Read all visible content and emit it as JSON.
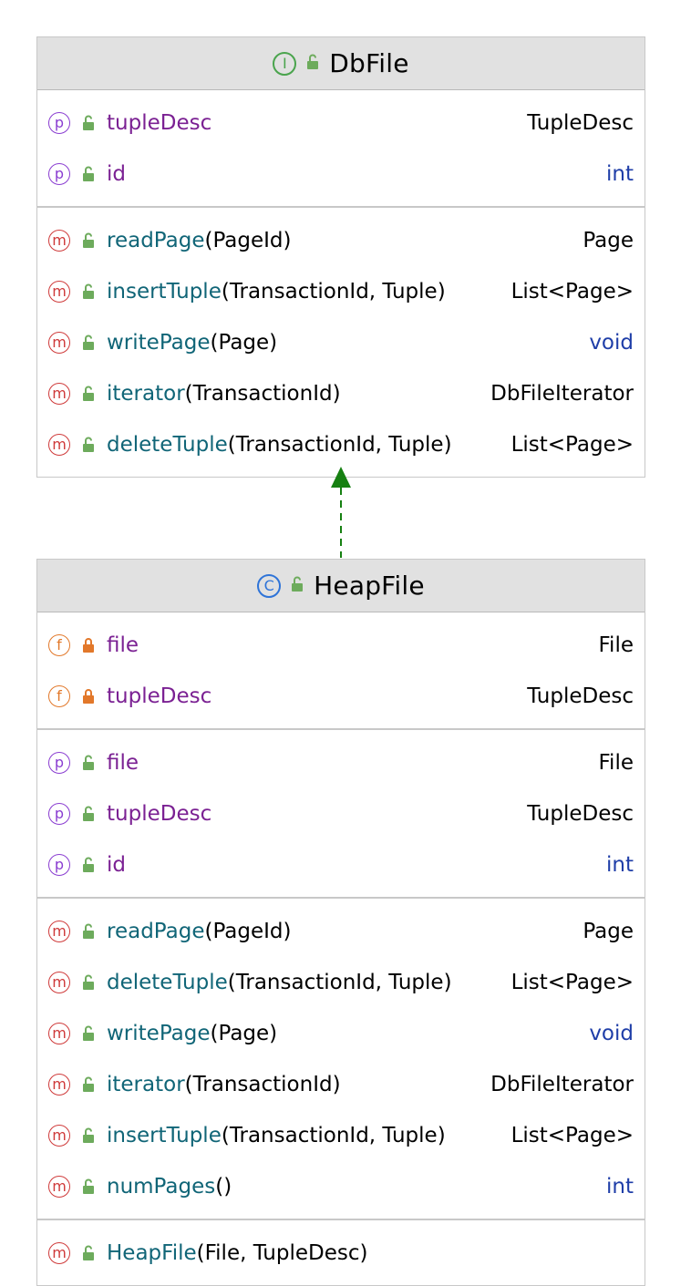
{
  "colors": {
    "header_bg": "#e1e1e1",
    "field_name": "#7b2193",
    "method_name": "#106577",
    "primitive_type": "#1f3ea8",
    "interface_icon": "#4aa44d",
    "class_icon": "#2f74d8",
    "arrow": "#168011",
    "visibility_public": "#6dab5c",
    "visibility_private": "#e2782a"
  },
  "interface": {
    "name": "DbFile",
    "kind_icon": "interface-icon",
    "kind_glyph": "I",
    "sections": [
      {
        "rows": [
          {
            "kind": "p",
            "vis": "public",
            "name": "tupleDesc",
            "args": "",
            "type": "TupleDesc",
            "type_primitive": false
          },
          {
            "kind": "p",
            "vis": "public",
            "name": "id",
            "args": "",
            "type": "int",
            "type_primitive": true
          }
        ]
      },
      {
        "rows": [
          {
            "kind": "m-abs",
            "vis": "public",
            "name": "readPage",
            "args": "(PageId)",
            "type": "Page",
            "type_primitive": false
          },
          {
            "kind": "m-abs",
            "vis": "public",
            "name": "insertTuple",
            "args": "(TransactionId, Tuple)",
            "type": "List<Page>",
            "type_primitive": false
          },
          {
            "kind": "m-abs",
            "vis": "public",
            "name": "writePage",
            "args": "(Page)",
            "type": "void",
            "type_primitive": true
          },
          {
            "kind": "m-abs",
            "vis": "public",
            "name": "iterator",
            "args": "(TransactionId)",
            "type": "DbFileIterator",
            "type_primitive": false
          },
          {
            "kind": "m-abs",
            "vis": "public",
            "name": "deleteTuple",
            "args": "(TransactionId, Tuple)",
            "type": "List<Page>",
            "type_primitive": false
          }
        ]
      }
    ]
  },
  "class": {
    "name": "HeapFile",
    "kind_icon": "class-icon",
    "kind_glyph": "C",
    "sections": [
      {
        "rows": [
          {
            "kind": "f",
            "vis": "private",
            "name": "file",
            "args": "",
            "type": "File",
            "type_primitive": false
          },
          {
            "kind": "f",
            "vis": "private",
            "name": "tupleDesc",
            "args": "",
            "type": "TupleDesc",
            "type_primitive": false
          }
        ]
      },
      {
        "rows": [
          {
            "kind": "p",
            "vis": "public",
            "name": "file",
            "args": "",
            "type": "File",
            "type_primitive": false
          },
          {
            "kind": "p",
            "vis": "public",
            "name": "tupleDesc",
            "args": "",
            "type": "TupleDesc",
            "type_primitive": false
          },
          {
            "kind": "p",
            "vis": "public",
            "name": "id",
            "args": "",
            "type": "int",
            "type_primitive": true
          }
        ]
      },
      {
        "rows": [
          {
            "kind": "m",
            "vis": "public",
            "name": "readPage",
            "args": "(PageId)",
            "type": "Page",
            "type_primitive": false
          },
          {
            "kind": "m",
            "vis": "public",
            "name": "deleteTuple",
            "args": "(TransactionId, Tuple)",
            "type": "List<Page>",
            "type_primitive": false
          },
          {
            "kind": "m",
            "vis": "public",
            "name": "writePage",
            "args": "(Page)",
            "type": "void",
            "type_primitive": true
          },
          {
            "kind": "m",
            "vis": "public",
            "name": "iterator",
            "args": "(TransactionId)",
            "type": "DbFileIterator",
            "type_primitive": false
          },
          {
            "kind": "m",
            "vis": "public",
            "name": "insertTuple",
            "args": "(TransactionId, Tuple)",
            "type": "List<Page>",
            "type_primitive": false
          },
          {
            "kind": "m",
            "vis": "public",
            "name": "numPages",
            "args": "()",
            "type": "int",
            "type_primitive": true
          }
        ]
      },
      {
        "rows": [
          {
            "kind": "m",
            "vis": "public",
            "name": "HeapFile",
            "args": "(File, TupleDesc)",
            "type": "",
            "type_primitive": false
          }
        ]
      }
    ]
  },
  "relation": {
    "type": "implements",
    "from": "HeapFile",
    "to": "DbFile",
    "style": "dashed"
  }
}
